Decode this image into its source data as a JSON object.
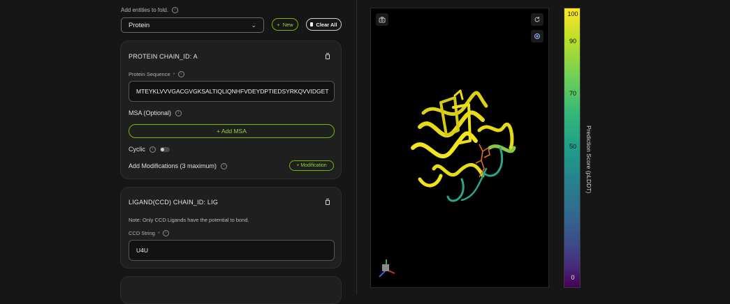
{
  "entities": {
    "label": "Add entities to fold.",
    "select_value": "Protein",
    "new_button": "New",
    "clear_button": "Clear All"
  },
  "protein_card": {
    "title": "PROTEIN CHAIN_ID: A",
    "sequence_label": "Protein Sequence",
    "required_mark": "*",
    "sequence_value": "MTEYKLVVVGACGVGKSALTIQLIQNHFVDEYDPTIEDSYRKQVVIDGET",
    "msa_label": "MSA (Optional)",
    "add_msa_button": "+ Add MSA",
    "cyclic_label": "Cyclic",
    "modifications_label": "Add Modifications (3 maximum)",
    "add_modification_button": "+ Modification"
  },
  "ligand_card": {
    "title": "LIGAND(CCD) CHAIN_ID: LIG",
    "note": "Note: Only CCD Ligands have the potential to bond.",
    "ccd_label": "CCD String",
    "required_mark": "*",
    "ccd_value": "U4U"
  },
  "colorbar": {
    "ticks": [
      "100",
      "90",
      "70",
      "50",
      "0"
    ],
    "label": "Prediction Score (pLDDT)"
  },
  "colors": {
    "accent": "#76b900",
    "background": "#161616",
    "card": "#1f1f1f",
    "protein_main": "#f0e418",
    "protein_tail": "#2aa68a",
    "ligand": "#e0701a"
  },
  "icons": [
    "info-icon",
    "chevron-down-icon",
    "plus-icon",
    "trash-icon",
    "camera-icon",
    "rotate-icon",
    "target-icon",
    "axes-icon"
  ]
}
